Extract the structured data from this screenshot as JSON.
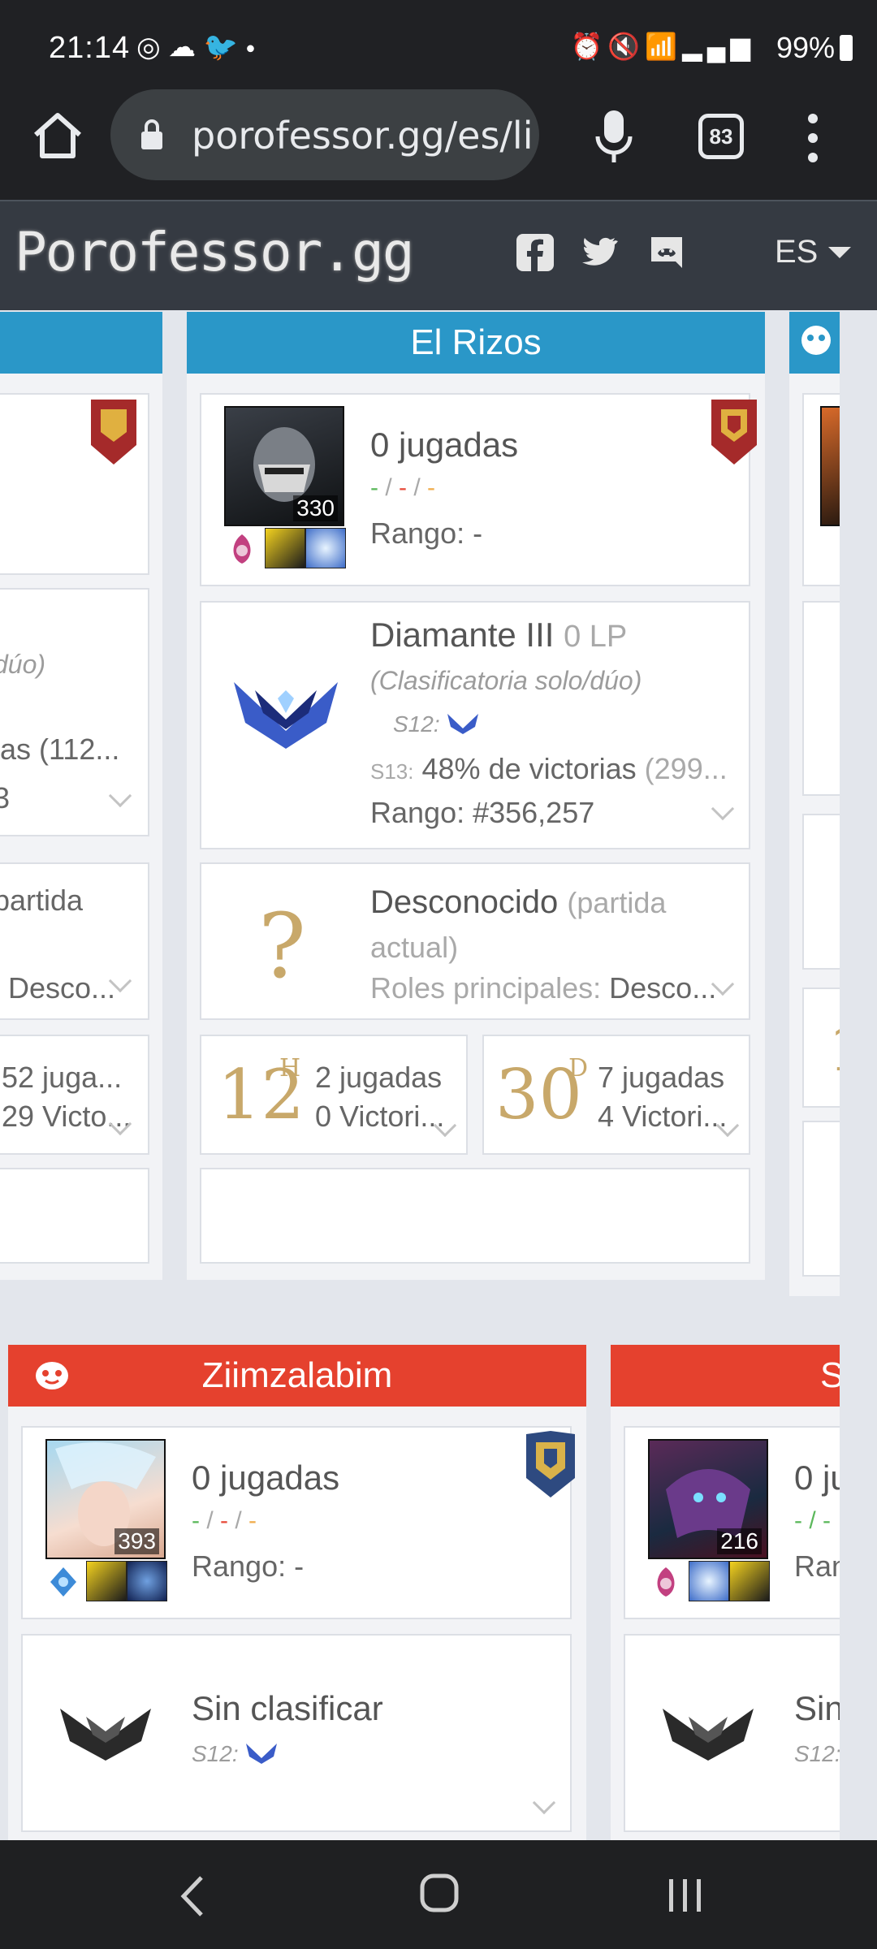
{
  "status": {
    "time": "21:14",
    "battery": "99%",
    "left_icons": [
      "whatsapp-icon",
      "cloud-icon",
      "twitter-icon",
      "dot-icon"
    ],
    "right_icons": [
      "alarm-icon",
      "mute-icon",
      "wifi-icon",
      "signal-icon",
      "battery-icon"
    ]
  },
  "browser": {
    "url": "porofessor.gg/es/li",
    "tab_count": "83"
  },
  "site": {
    "logo": "Porofessor.gg",
    "language": "ES"
  },
  "cards": {
    "left_partial": {
      "ranked_queue": "dúo)",
      "winrate": "ias (112...",
      "rank_suffix": "3",
      "current_game": "partida",
      "roles": "Desco...",
      "games_a": "52 juga...",
      "wins_a": "29 Victo..."
    },
    "el_rizos": {
      "name": "El Rizos",
      "champion_level": "330",
      "games_played": "0 jugadas",
      "kda": {
        "k": "-",
        "sep1": " / ",
        "d": "-",
        "sep2": " / ",
        "a": "-"
      },
      "rank_label": "Rango: -",
      "tier": "Diamante III",
      "lp": "0 LP",
      "queue": "(Clasificatoria solo/dúo)",
      "s12_label": "S12:",
      "s13_label": "S13:",
      "s13_winrate": "48% de victorias",
      "s13_games": "(299...",
      "ladder_rank": "Rango: #356,257",
      "current_role": "Desconocido",
      "current_role_suffix": "(partida actual)",
      "main_roles_label": "Roles principales:",
      "main_roles_value": "Desco...",
      "stat_12h": {
        "number": "12",
        "unit": "H",
        "games": "2 jugadas",
        "wins": "0 Victori..."
      },
      "stat_30d": {
        "number": "30",
        "unit": "D",
        "games": "7 jugadas",
        "wins": "4 Victori..."
      }
    },
    "ziimzalabim": {
      "name": "Ziimzalabim",
      "champion_level": "393",
      "games_played": "0 jugadas",
      "kda": {
        "k": "-",
        "sep1": " / ",
        "d": "-",
        "sep2": " / ",
        "a": "-"
      },
      "rank_label": "Rango: -",
      "tier": "Sin clasificar",
      "s12_label": "S12:"
    },
    "right_partial": {
      "name": "S",
      "champion_level": "216",
      "games_played": "0 ju",
      "kda": "- / -",
      "rank_label": "Ran",
      "tier": "Sin",
      "s12_label": "S12:"
    },
    "right_top_partial": {
      "digit": "1"
    }
  },
  "colors": {
    "blue_header": "#2a97c8",
    "red_header": "#e5412e",
    "kda_green": "#5cb85c",
    "kda_red": "#e74c3c",
    "kda_orange": "#f0ad4e",
    "gold": "#c8a86a"
  }
}
